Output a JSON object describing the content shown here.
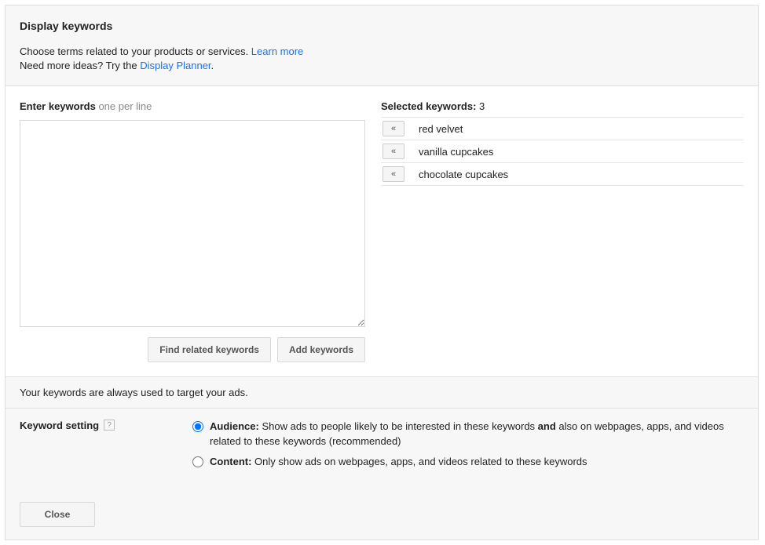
{
  "title": "Display keywords",
  "description_line1_prefix": "Choose terms related to your products or services. ",
  "description_line1_link": "Learn more",
  "description_line2_prefix": "Need more ideas? Try the ",
  "description_line2_link": "Display Planner",
  "description_line2_suffix": ".",
  "enter_keywords_label": "Enter keywords",
  "enter_keywords_hint": " one per line",
  "btn_find_related": "Find related keywords",
  "btn_add_keywords": "Add keywords",
  "selected_keywords_label": "Selected keywords",
  "selected_keywords_count": "3",
  "selected": [
    "red velvet",
    "vanilla cupcakes",
    "chocolate cupcakes"
  ],
  "remove_glyph": "«",
  "info_text": "Your keywords are always used to target your ads.",
  "keyword_setting_label": "Keyword setting",
  "help_glyph": "?",
  "options": {
    "audience_label": "Audience:",
    "audience_text_part1": " Show ads to people likely to be interested in these keywords ",
    "audience_text_bold": "and",
    "audience_text_part2": " also on webpages, apps, and videos related to these keywords (recommended)",
    "content_label": "Content:",
    "content_text": " Only show ads on webpages, apps, and videos related to these keywords"
  },
  "btn_close": "Close"
}
